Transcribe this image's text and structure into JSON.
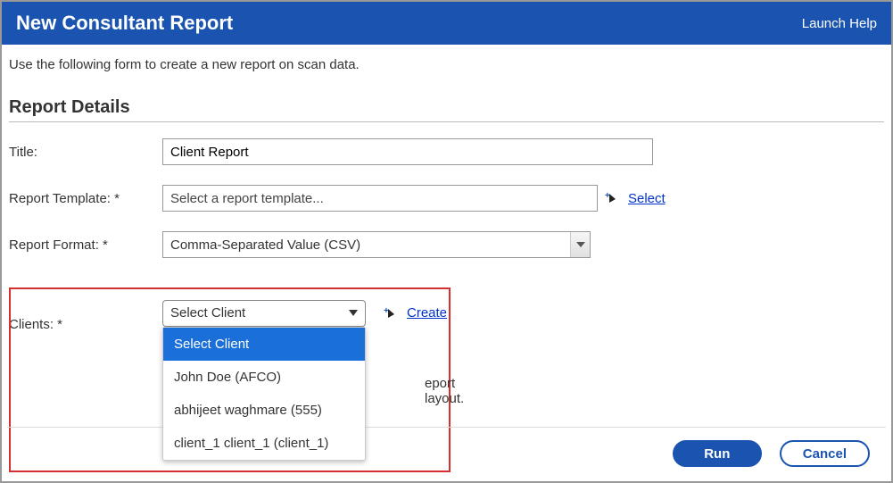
{
  "header": {
    "title": "New Consultant Report",
    "help": "Launch Help"
  },
  "intro": "Use the following form to create a new report on scan data.",
  "section": "Report Details",
  "form": {
    "title_label": "Title:",
    "title_value": "Client Report",
    "template_label": "Report Template: *",
    "template_value": "Select a report template...",
    "template_action": "Select",
    "format_label": "Report Format: *",
    "format_value": "Comma-Separated Value (CSV)",
    "clients_label": "Clients: *",
    "clients_selected": "Select Client",
    "clients_action": "Create",
    "clients_options": {
      "opt0": "Select Client",
      "opt1": "John Doe (AFCO)",
      "opt2": "abhijeet waghmare (555)",
      "opt3": "client_1 client_1 (client_1)"
    },
    "hint_fragment": "eport layout."
  },
  "footer": {
    "run": "Run",
    "cancel": "Cancel"
  }
}
